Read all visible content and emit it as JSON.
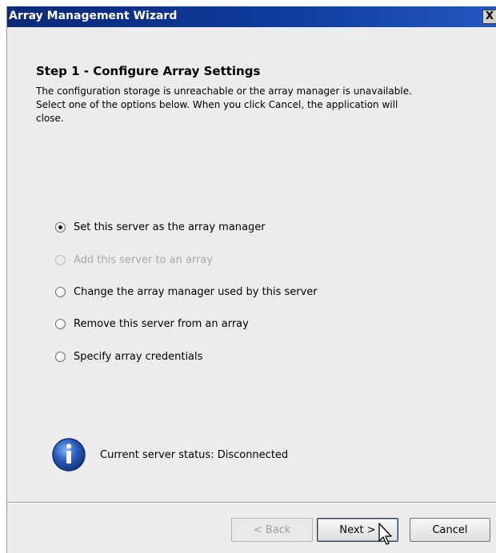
{
  "window": {
    "title": "Array Management Wizard",
    "close_label": "X"
  },
  "step": {
    "title": "Step 1 - Configure Array Settings",
    "description_lines": [
      "The configuration storage is unreachable or the array manager is unavailable.",
      "Select one of the options below. When you click Cancel, the application will",
      "close."
    ]
  },
  "options": [
    {
      "label": "Set this server as the array manager",
      "checked": true,
      "enabled": true
    },
    {
      "label": "Add this server to an array",
      "checked": false,
      "enabled": false
    },
    {
      "label": "Change the array manager used by this server",
      "checked": false,
      "enabled": true
    },
    {
      "label": "Remove this server from an array",
      "checked": false,
      "enabled": true
    },
    {
      "label": "Specify array credentials",
      "checked": false,
      "enabled": true
    }
  ],
  "status": {
    "icon": "info-icon",
    "text": "Current server status:  Disconnected"
  },
  "buttons": {
    "back": "< Back",
    "next": "Next >",
    "cancel": "Cancel"
  },
  "colors": {
    "titlebar": "#0b2a78",
    "dialog_bg": "#ececec",
    "info_icon": "#2a5bb8"
  }
}
